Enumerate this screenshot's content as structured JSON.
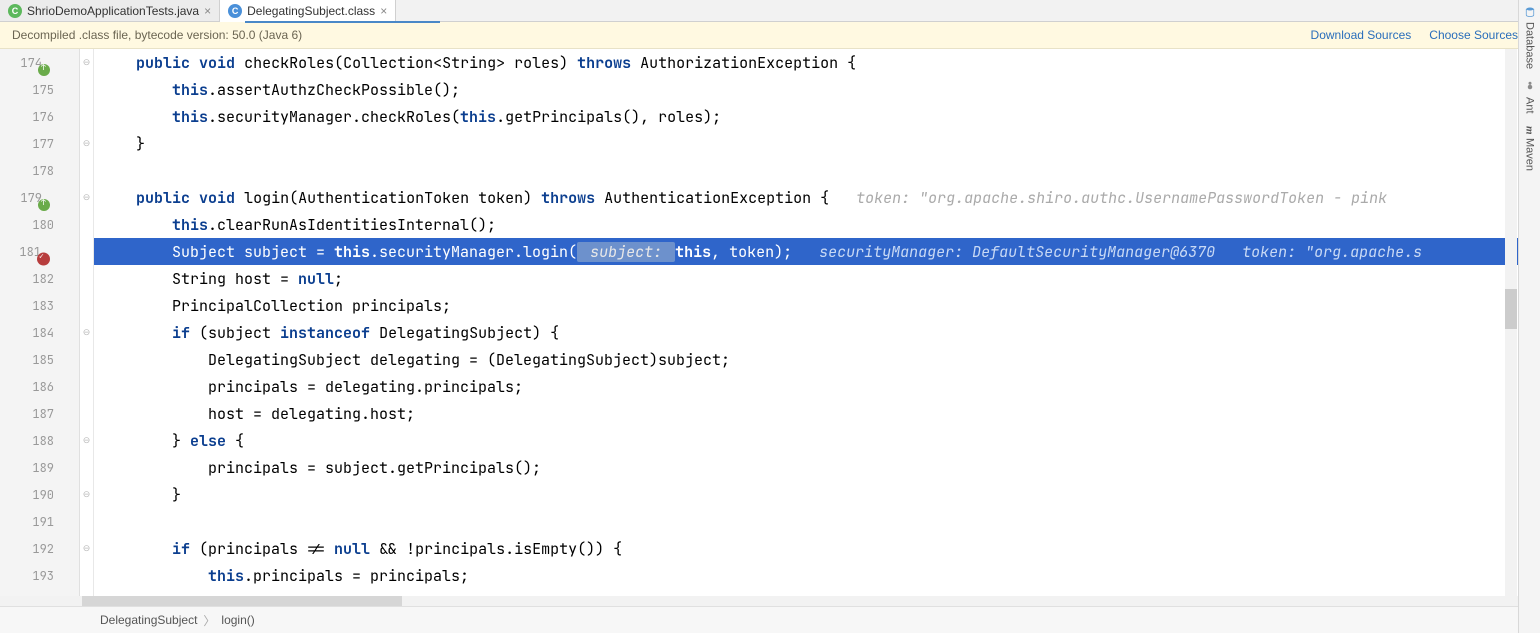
{
  "tabs": [
    {
      "label": "ShrioDemoApplicationTests.java",
      "iconColor": "green"
    },
    {
      "label": "DelegatingSubject.class",
      "iconColor": "blue"
    }
  ],
  "infoBar": {
    "message": "Decompiled .class file, bytecode version: 50.0 (Java 6)",
    "downloadSources": "Download Sources",
    "chooseSources": "Choose Sources..."
  },
  "rightTools": {
    "database": "Database",
    "ant": "Ant",
    "maven": "Maven"
  },
  "breadcrumbs": {
    "item1": "DelegatingSubject",
    "item2": "login()"
  },
  "gutter": [
    {
      "n": "174",
      "icon": "override"
    },
    {
      "n": "175"
    },
    {
      "n": "176"
    },
    {
      "n": "177"
    },
    {
      "n": "178"
    },
    {
      "n": "179",
      "icon": "override"
    },
    {
      "n": "180"
    },
    {
      "n": "181",
      "icon": "breakpoint"
    },
    {
      "n": "182"
    },
    {
      "n": "183"
    },
    {
      "n": "184"
    },
    {
      "n": "185"
    },
    {
      "n": "186"
    },
    {
      "n": "187"
    },
    {
      "n": "188"
    },
    {
      "n": "189"
    },
    {
      "n": "190"
    },
    {
      "n": "191"
    },
    {
      "n": "192"
    },
    {
      "n": "193"
    }
  ],
  "code": {
    "l174": {
      "ind": "    ",
      "kw1": "public",
      "sp1": " ",
      "kw2": "void",
      "txt1": " checkRoles(Collection<String> roles) ",
      "kw3": "throws",
      "txt2": " AuthorizationException {"
    },
    "l175": {
      "ind": "        ",
      "kw1": "this",
      "txt1": ".assertAuthzCheckPossible();"
    },
    "l176": {
      "ind": "        ",
      "kw1": "this",
      "txt1": ".securityManager.checkRoles(",
      "kw2": "this",
      "txt2": ".getPrincipals(), roles);"
    },
    "l177": {
      "ind": "    ",
      "txt1": "}"
    },
    "l178": {
      "ind": ""
    },
    "l179": {
      "ind": "    ",
      "kw1": "public",
      "sp1": " ",
      "kw2": "void",
      "txt1": " login(AuthenticationToken token) ",
      "kw3": "throws",
      "txt2": " AuthenticationException {   ",
      "hint1": "token: \"org.apache.shiro.authc.UsernamePasswordToken - pink"
    },
    "l180": {
      "ind": "        ",
      "kw1": "this",
      "txt1": ".clearRunAsIdentitiesInternal();"
    },
    "l181": {
      "ind": "        ",
      "txt1": "Subject subject = ",
      "kw1": "this",
      "txt2": ".securityManager.login(",
      "param": " subject: ",
      "kw2": "this",
      "txt3": ", token);   ",
      "hint1": "securityManager: DefaultSecurityManager@6370   token: \"org.apache.s"
    },
    "l182": {
      "ind": "        ",
      "txt1": "String host = ",
      "kw1": "null",
      "txt2": ";"
    },
    "l183": {
      "ind": "        ",
      "txt1": "PrincipalCollection principals;"
    },
    "l184": {
      "ind": "        ",
      "kw1": "if",
      "txt1": " (subject ",
      "kw2": "instanceof",
      "txt2": " DelegatingSubject) {"
    },
    "l185": {
      "ind": "            ",
      "txt1": "DelegatingSubject delegating = (DelegatingSubject)subject;"
    },
    "l186": {
      "ind": "            ",
      "txt1": "principals = delegating.principals;"
    },
    "l187": {
      "ind": "            ",
      "txt1": "host = delegating.host;"
    },
    "l188": {
      "ind": "        ",
      "txt1": "} ",
      "kw1": "else",
      "txt2": " {"
    },
    "l189": {
      "ind": "            ",
      "txt1": "principals = subject.getPrincipals();"
    },
    "l190": {
      "ind": "        ",
      "txt1": "}"
    },
    "l191": {
      "ind": ""
    },
    "l192": {
      "ind": "        ",
      "kw1": "if",
      "txt1": " (principals != ",
      "kw2": "null",
      "txt2": " && !principals.isEmpty()) {"
    },
    "l193": {
      "ind": "            ",
      "kw1": "this",
      "txt1": ".principals = principals;"
    }
  }
}
